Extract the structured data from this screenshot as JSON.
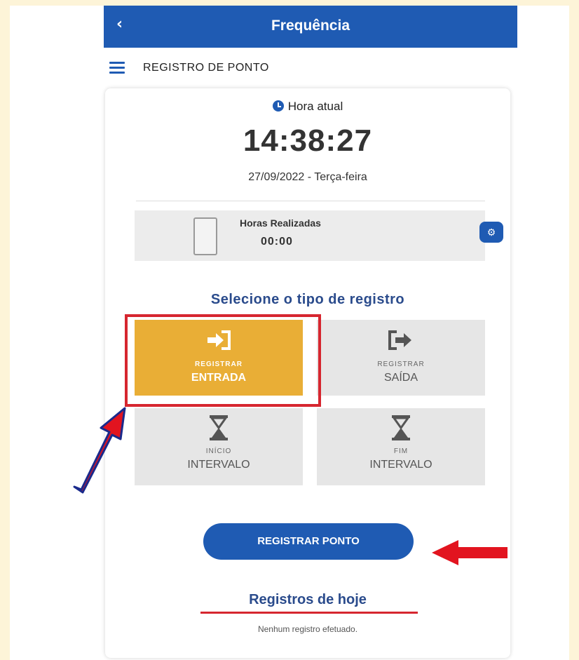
{
  "app": {
    "title": "Frequência",
    "back_label": "‹",
    "section_title": "REGISTRO DE PONTO"
  },
  "clock": {
    "label": "Hora atual",
    "time": "14:38:27",
    "date": "27/09/2022 - Terça-feira"
  },
  "hours": {
    "label": "Horas Realizadas",
    "value": "00:00"
  },
  "selection": {
    "title": "Selecione o tipo de registro",
    "options": [
      {
        "small": "REGISTRAR",
        "big": "ENTRADA",
        "icon": "enter-icon",
        "selected": true
      },
      {
        "small": "REGISTRAR",
        "big": "SAÍDA",
        "icon": "exit-icon",
        "selected": false
      },
      {
        "small": "INÍCIO",
        "big": "INTERVALO",
        "icon": "hourglass-icon",
        "selected": false
      },
      {
        "small": "FIM",
        "big": "INTERVALO",
        "icon": "hourglass-icon",
        "selected": false
      }
    ]
  },
  "action": {
    "register_label": "REGISTRAR PONTO"
  },
  "today": {
    "title": "Registros de hoje",
    "empty_text": "Nenhum registro efetuado."
  },
  "colors": {
    "primary": "#1f5bb3",
    "accent": "#e9ae36",
    "highlight": "#d6262f",
    "background": "#fdf4d8"
  }
}
